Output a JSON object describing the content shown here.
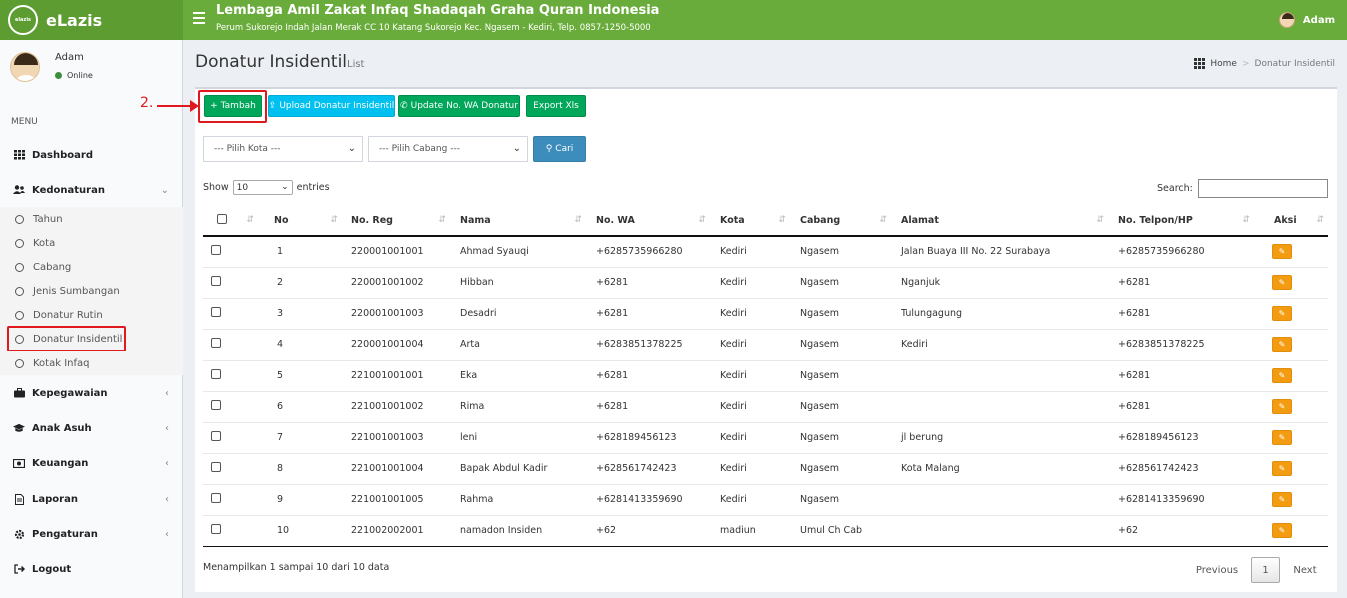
{
  "app": {
    "name": "eLazis",
    "logo_text": "elazis"
  },
  "header": {
    "org_name": "Lembaga Amil Zakat Infaq Shadaqah Graha Quran Indonesia",
    "org_address": "Perum Sukorejo Indah Jalan Merak CC 10 Katang Sukorejo Kec. Ngasem - Kediri, Telp. 0857-1250-5000",
    "user": "Adam"
  },
  "sidebar": {
    "user_name": "Adam",
    "status": "Online",
    "menu_header": "MENU",
    "items": [
      {
        "label": "Dashboard",
        "icon": "th-icon"
      },
      {
        "label": "Kedonaturan",
        "icon": "users-icon"
      },
      {
        "label": "Kepegawaian",
        "icon": "briefcase-icon"
      },
      {
        "label": "Anak Asuh",
        "icon": "graduation-cap-icon"
      },
      {
        "label": "Keuangan",
        "icon": "money-icon"
      },
      {
        "label": "Laporan",
        "icon": "file-icon"
      },
      {
        "label": "Pengaturan",
        "icon": "cogs-icon"
      },
      {
        "label": "Logout",
        "icon": "sign-out-icon"
      }
    ],
    "subitems": [
      "Tahun",
      "Kota",
      "Cabang",
      "Jenis Sumbangan",
      "Donatur Rutin",
      "Donatur Insidentil",
      "Kotak Infaq"
    ]
  },
  "page": {
    "title": "Donatur Insidentil",
    "subtitle": "List",
    "breadcrumb": {
      "home": "Home",
      "current": "Donatur Insidentil"
    }
  },
  "annotation": {
    "step_label": "2."
  },
  "toolbar": {
    "add_label": "Tambah",
    "upload_label": "Upload Donatur Insidentil",
    "update_wa_label": "Update No. WA Donatur",
    "export_label": "Export Xls"
  },
  "filters": {
    "kota_placeholder": "--- Pilih Kota ---",
    "cabang_placeholder": "--- Pilih Cabang ---",
    "search_button": "Cari"
  },
  "datatable": {
    "show_label": "Show",
    "entries_value": "10",
    "entries_label": "entries",
    "search_label": "Search:",
    "columns": [
      "No",
      "No. Reg",
      "Nama",
      "No. WA",
      "Kota",
      "Cabang",
      "Alamat",
      "No. Telpon/HP",
      "Aksi"
    ],
    "rows": [
      [
        "1",
        "220001001001",
        "Ahmad Syauqi",
        "+6285735966280",
        "Kediri",
        "Ngasem",
        "Jalan Buaya III No. 22 Surabaya",
        "+6285735966280"
      ],
      [
        "2",
        "220001001002",
        "Hibban",
        "+6281",
        "Kediri",
        "Ngasem",
        "Nganjuk",
        "+6281"
      ],
      [
        "3",
        "220001001003",
        "Desadri",
        "+6281",
        "Kediri",
        "Ngasem",
        "Tulungagung",
        "+6281"
      ],
      [
        "4",
        "220001001004",
        "Arta",
        "+6283851378225",
        "Kediri",
        "Ngasem",
        "Kediri",
        "+6283851378225"
      ],
      [
        "5",
        "221001001001",
        "Eka",
        "+6281",
        "Kediri",
        "Ngasem",
        "",
        "+6281"
      ],
      [
        "6",
        "221001001002",
        "Rima",
        "+6281",
        "Kediri",
        "Ngasem",
        "",
        "+6281"
      ],
      [
        "7",
        "221001001003",
        "leni",
        "+628189456123",
        "Kediri",
        "Ngasem",
        "jl berung",
        "+628189456123"
      ],
      [
        "8",
        "221001001004",
        "Bapak Abdul Kadir",
        "+628561742423",
        "Kediri",
        "Ngasem",
        "Kota Malang",
        "+628561742423"
      ],
      [
        "9",
        "221001001005",
        "Rahma",
        "+6281413359690",
        "Kediri",
        "Ngasem",
        "",
        "+6281413359690"
      ],
      [
        "10",
        "221002002001",
        "namadon Insiden",
        "+62",
        "madiun",
        "Umul Ch Cab",
        "",
        "+62"
      ]
    ],
    "info": "Menampilkan 1 sampai 10 dari 10 data",
    "pagination": {
      "previous": "Previous",
      "current": "1",
      "next": "Next"
    }
  },
  "colors": {
    "header_green": "#6aac3b",
    "highlight_red": "#e0191f",
    "edit_orange": "#f39c12"
  }
}
